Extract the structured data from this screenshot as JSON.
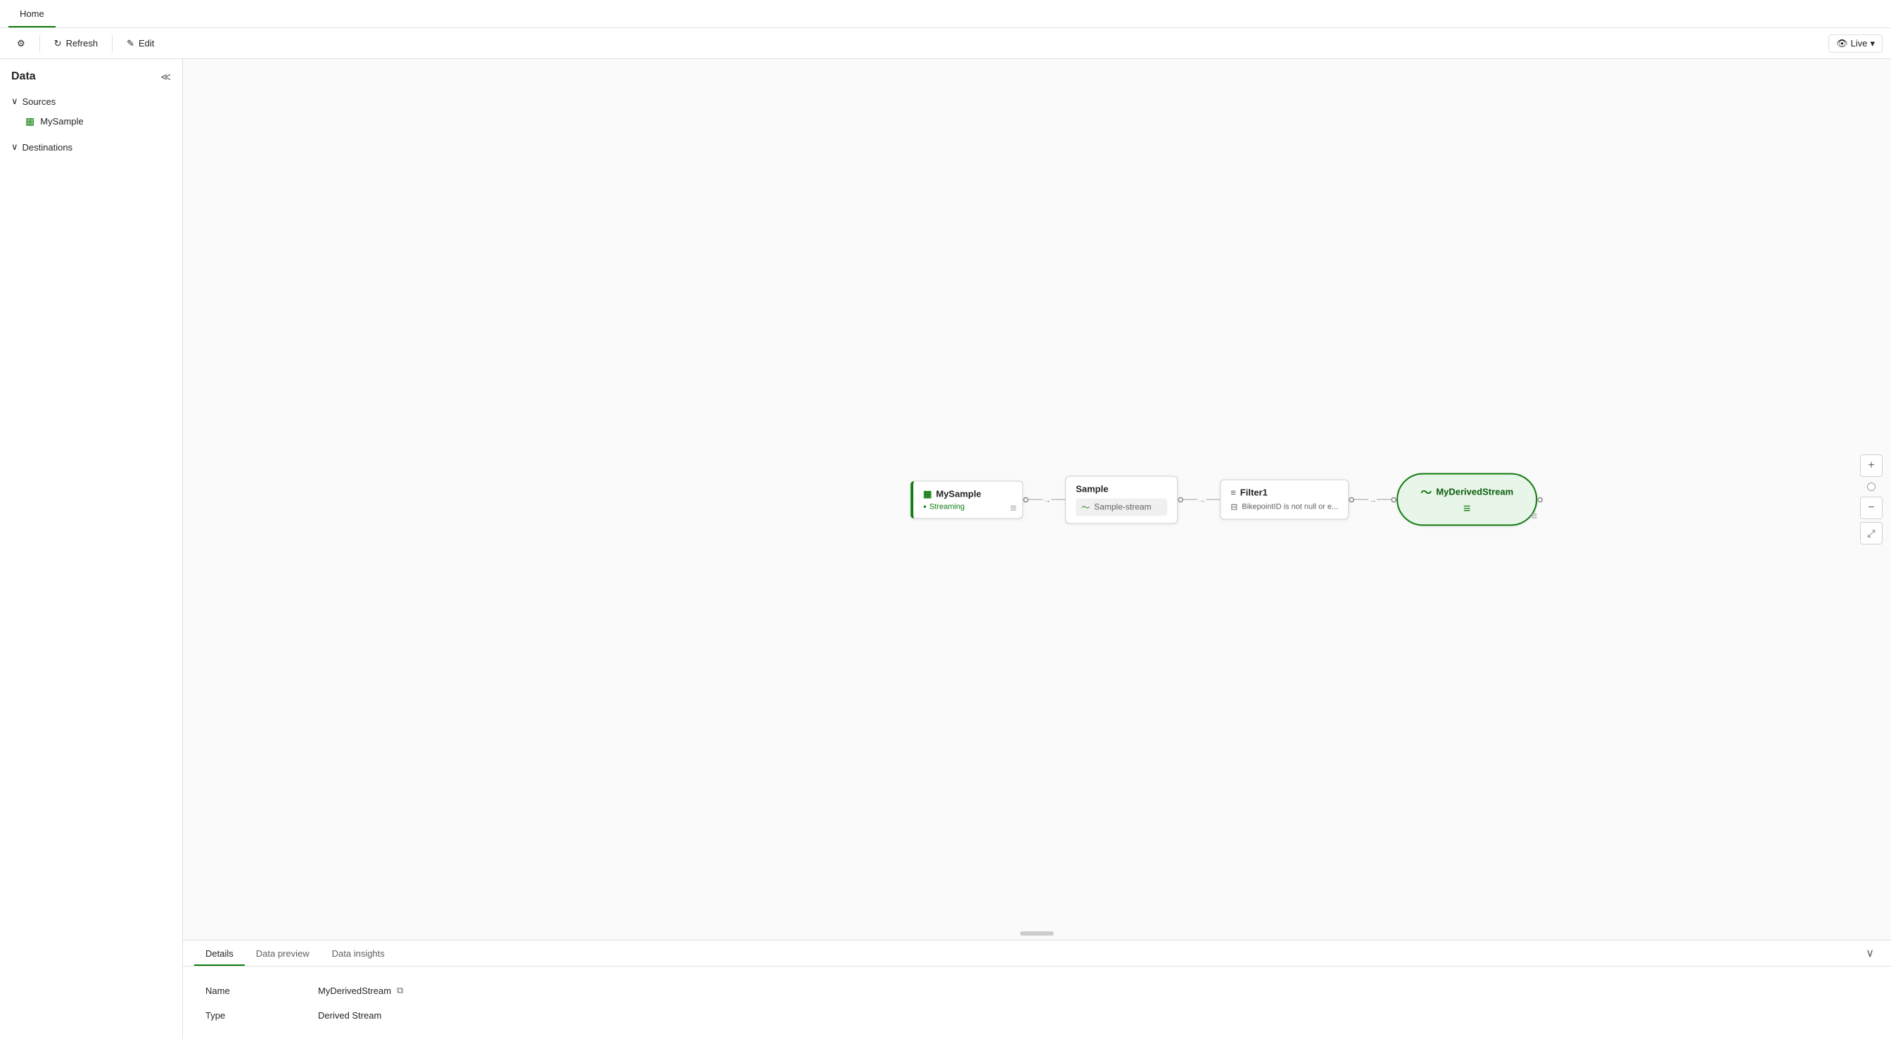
{
  "tabs": [
    {
      "id": "home",
      "label": "Home",
      "active": true
    }
  ],
  "toolbar": {
    "settings_label": "Settings",
    "refresh_label": "Refresh",
    "edit_label": "Edit",
    "live_label": "Live",
    "live_icon": "👁"
  },
  "sidebar": {
    "title": "Data",
    "sections": [
      {
        "id": "sources",
        "label": "Sources",
        "expanded": true,
        "items": [
          {
            "id": "mysample",
            "label": "MySample"
          }
        ]
      },
      {
        "id": "destinations",
        "label": "Destinations",
        "expanded": false,
        "items": []
      }
    ]
  },
  "canvas": {
    "nodes": {
      "source": {
        "name": "MySample",
        "status": "Streaming"
      },
      "stream": {
        "title": "Sample",
        "subtitle": "Sample-stream"
      },
      "filter": {
        "title": "Filter1",
        "condition": "BikepointID is not null or e..."
      },
      "derived": {
        "name": "MyDerivedStream"
      }
    }
  },
  "bottom_panel": {
    "tabs": [
      {
        "id": "details",
        "label": "Details",
        "active": true
      },
      {
        "id": "data-preview",
        "label": "Data preview",
        "active": false
      },
      {
        "id": "data-insights",
        "label": "Data insights",
        "active": false
      }
    ],
    "details": {
      "name_label": "Name",
      "name_value": "MyDerivedStream",
      "type_label": "Type",
      "type_value": "Derived Stream"
    }
  },
  "icons": {
    "chevron_left": "«",
    "chevron_right": "»",
    "chevron_down": "∨",
    "chevron_up": "∧",
    "expand_down": "⌄",
    "collapse": "⟨⟩",
    "settings": "⚙",
    "refresh": "↻",
    "edit": "✎",
    "copy": "⧉",
    "zoom_in": "+",
    "zoom_out": "−",
    "fit": "⤢",
    "eye": "👁",
    "table": "▦",
    "stream": "〜",
    "filter": "≡",
    "equals": "≡",
    "dot": "●",
    "streaming_dot": "●"
  }
}
